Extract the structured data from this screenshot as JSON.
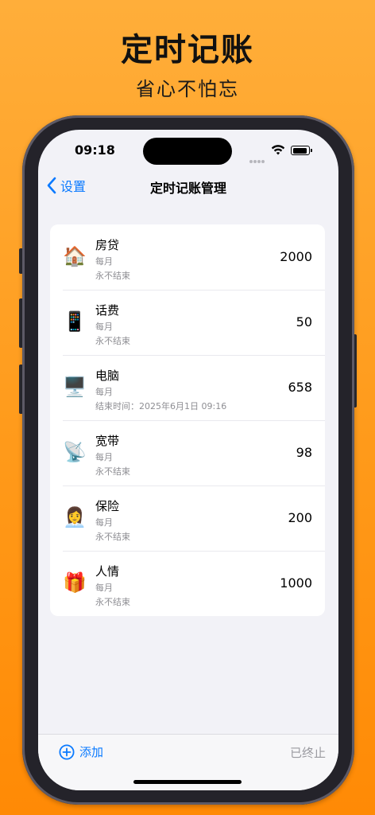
{
  "promo": {
    "title": "定时记账",
    "subtitle": "省心不怕忘"
  },
  "status_bar": {
    "time": "09:18",
    "icons": [
      "signal-icon",
      "wifi-icon",
      "battery-icon"
    ]
  },
  "nav": {
    "back_label": "设置",
    "title": "定时记账管理"
  },
  "items": [
    {
      "emoji": "🏠",
      "name": "房贷",
      "frequency": "每月",
      "end": "永不结束",
      "amount": "2000"
    },
    {
      "emoji": "📱",
      "name": "话费",
      "frequency": "每月",
      "end": "永不结束",
      "amount": "50"
    },
    {
      "emoji": "🖥️",
      "name": "电脑",
      "frequency": "每月",
      "end": "结束时间：2025年6月1日 09:16",
      "amount": "658"
    },
    {
      "emoji": "📡",
      "name": "宽带",
      "frequency": "每月",
      "end": "永不结束",
      "amount": "98"
    },
    {
      "emoji": "👩‍💼",
      "name": "保险",
      "frequency": "每月",
      "end": "永不结束",
      "amount": "200"
    },
    {
      "emoji": "🎁",
      "name": "人情",
      "frequency": "每月",
      "end": "永不结束",
      "amount": "1000"
    }
  ],
  "toolbar": {
    "add_label": "添加",
    "ended_label": "已终止"
  },
  "colors": {
    "accent": "#0A7AFF",
    "background_top": "#FFAE3A",
    "background_bottom": "#FF8A05",
    "screen_bg": "#F2F2F7"
  }
}
